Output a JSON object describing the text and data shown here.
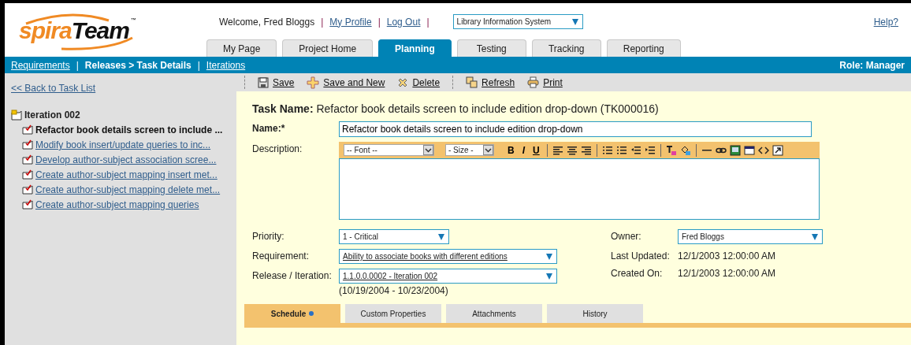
{
  "logo": {
    "first": "spira",
    "second": "Team",
    "mark": "™"
  },
  "header": {
    "welcome": "Welcome, Fred Bloggs",
    "links": [
      "My Profile",
      "Log Out"
    ],
    "separators": [
      "|",
      "|",
      "|"
    ],
    "project": "Library Information System",
    "help": "Help?"
  },
  "main_tabs": [
    {
      "label": "My Page",
      "selected": false
    },
    {
      "label": "Project Home",
      "selected": false
    },
    {
      "label": "Planning",
      "selected": true
    },
    {
      "label": "Testing",
      "selected": false
    },
    {
      "label": "Tracking",
      "selected": false
    },
    {
      "label": "Reporting",
      "selected": false
    }
  ],
  "sub_nav": {
    "items": [
      {
        "label": "Requirements",
        "selected": false
      },
      {
        "label": "Releases > Task Details",
        "selected": true
      },
      {
        "label": "Iterations",
        "selected": false
      }
    ],
    "separators": [
      "|",
      "|"
    ],
    "role": "Role: Manager"
  },
  "sidebar": {
    "back_link": "<< Back to Task List",
    "tree": {
      "label": "Iteration 002",
      "children": [
        {
          "label": "Refactor book details screen to include ...",
          "selected": true
        },
        {
          "label": "Modify book insert/update queries to inc...",
          "selected": false
        },
        {
          "label": "Develop author-subject association scree...",
          "selected": false
        },
        {
          "label": "Create author-subject mapping insert met...",
          "selected": false
        },
        {
          "label": "Create author-subject mapping delete met...",
          "selected": false
        },
        {
          "label": "Create author-subject mapping queries",
          "selected": false
        }
      ]
    }
  },
  "toolbar": [
    [
      "Save",
      "Save and New",
      "Delete"
    ],
    [
      "Refresh",
      "Print"
    ]
  ],
  "task": {
    "heading_label": "Task Name:",
    "heading_value": "Refactor book details screen to include edition drop-down (TK000016)",
    "name_label": "Name:*",
    "name_value": "Refactor book details screen to include edition drop-down",
    "description_label": "Description:",
    "font_select": "-- Font --",
    "size_select": "- Size -",
    "format_buttons": [
      "B",
      "I",
      "U"
    ],
    "priority_label": "Priority:",
    "priority": "1 - Critical",
    "requirement_label": "Requirement:",
    "requirement": "Ability to associate books with different editions",
    "release_label": "Release / Iteration:",
    "release": "1.1.0.0.0002 - Iteration 002",
    "release_dates": "(10/19/2004 - 10/23/2004)",
    "owner_label": "Owner:",
    "owner": "Fred Bloggs",
    "last_updated_label": "Last Updated:",
    "last_updated": "12/1/2003 12:00:00 AM",
    "created_label": "Created On:",
    "created": "12/1/2003 12:00:00 AM"
  },
  "detail_tabs": [
    {
      "label": "Schedule",
      "selected": true
    },
    {
      "label": "Custom Properties",
      "selected": false
    },
    {
      "label": "Attachments",
      "selected": false
    },
    {
      "label": "History",
      "selected": false
    }
  ]
}
